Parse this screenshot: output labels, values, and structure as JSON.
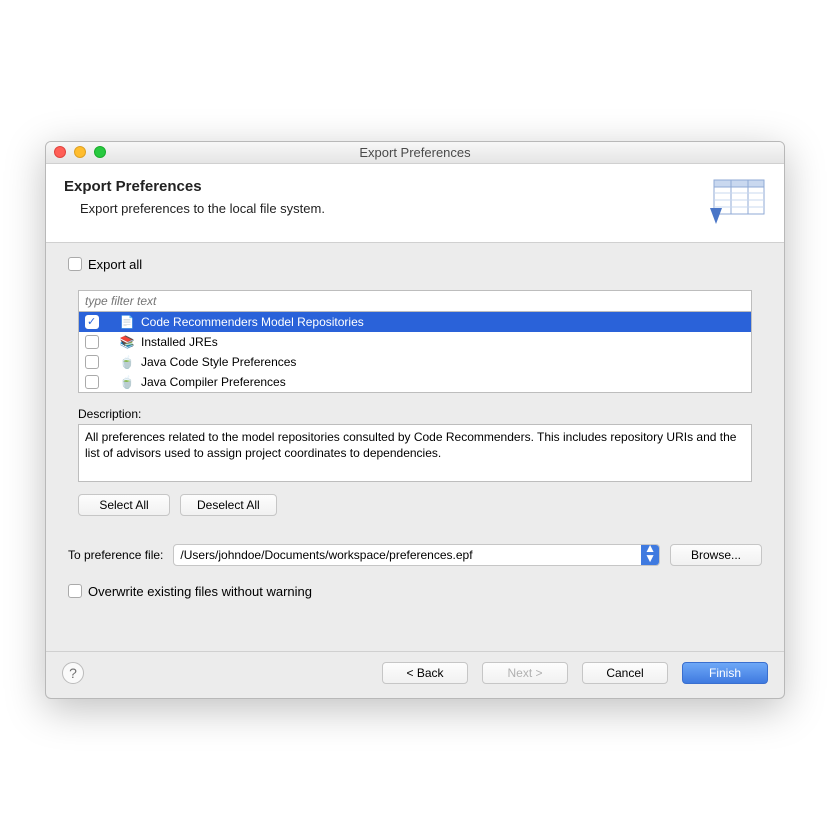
{
  "window": {
    "title": "Export Preferences"
  },
  "header": {
    "title": "Export Preferences",
    "subtitle": "Export preferences to the local file system."
  },
  "exportAll": {
    "label": "Export all"
  },
  "filter": {
    "placeholder": "type filter text"
  },
  "tree": {
    "items": [
      {
        "label": "Code Recommenders Model Repositories",
        "checked": true,
        "selected": true,
        "icon": "📄"
      },
      {
        "label": "Installed JREs",
        "checked": false,
        "selected": false,
        "icon": "📚"
      },
      {
        "label": "Java Code Style Preferences",
        "checked": false,
        "selected": false,
        "icon": "🍵"
      },
      {
        "label": "Java Compiler Preferences",
        "checked": false,
        "selected": false,
        "icon": "🍵"
      }
    ]
  },
  "description": {
    "label": "Description:",
    "text": "All preferences related to the model repositories consulted by Code Recommenders. This includes repository URIs and the list of advisors used to assign project coordinates to dependencies."
  },
  "buttons": {
    "selectAll": "Select All",
    "deselectAll": "Deselect All",
    "browse": "Browse...",
    "back": "< Back",
    "next": "Next >",
    "cancel": "Cancel",
    "finish": "Finish"
  },
  "fileRow": {
    "label": "To preference file:",
    "value": "/Users/johndoe/Documents/workspace/preferences.epf"
  },
  "overwrite": {
    "label": "Overwrite existing files without warning"
  }
}
